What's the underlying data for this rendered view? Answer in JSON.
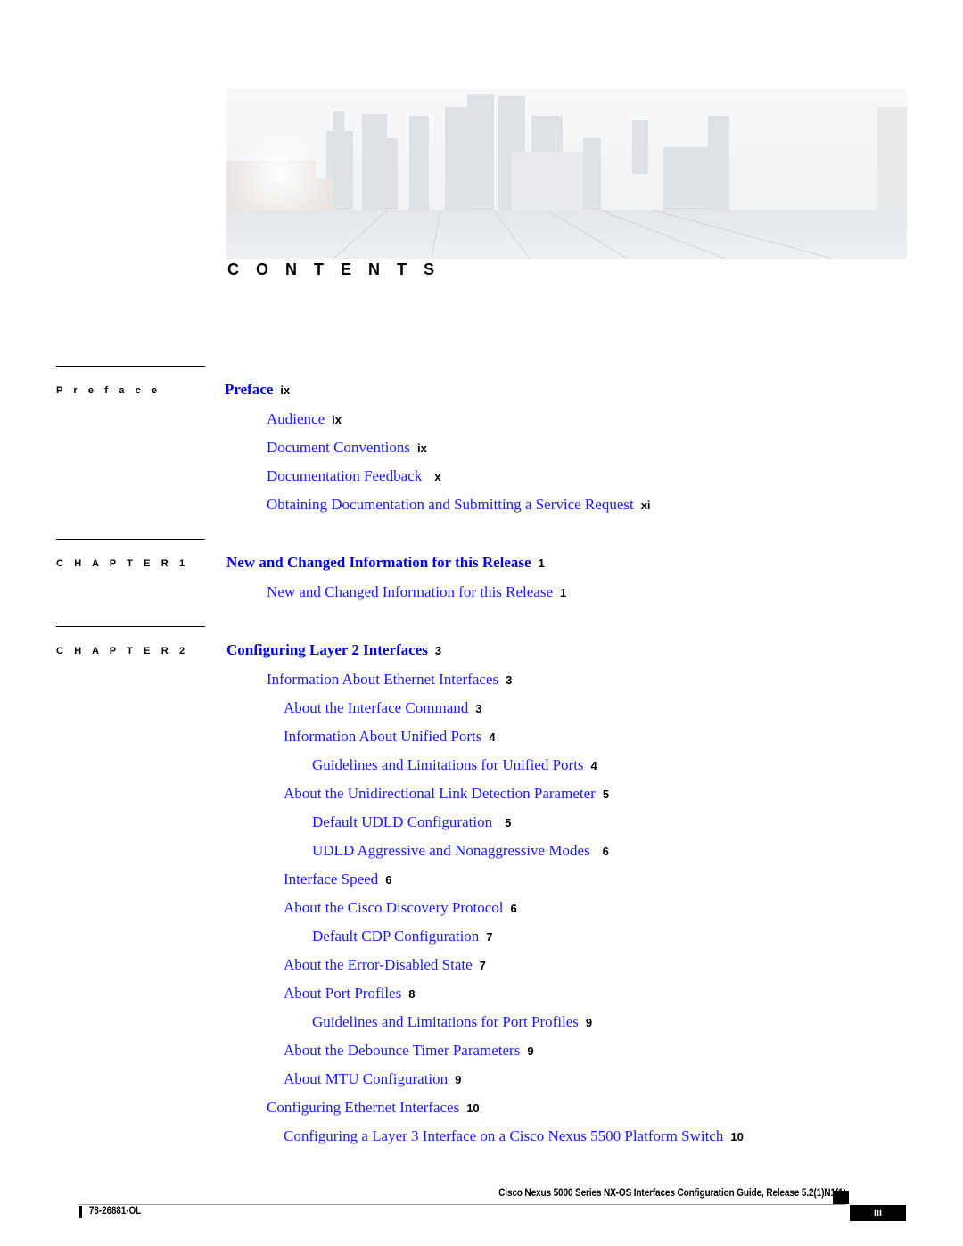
{
  "header": {
    "banner_alt": "city-skyline-bridge-photo",
    "title": "C O N T E N T S"
  },
  "sections": [
    {
      "label": "P r e f a c e",
      "heading": {
        "title": "Preface",
        "page": "ix"
      },
      "entries": [
        {
          "title": "Audience",
          "page": "ix",
          "level": 1
        },
        {
          "title": "Document Conventions",
          "page": "ix",
          "level": 1
        },
        {
          "title": "Documentation Feedback",
          "page": "x",
          "level": 1
        },
        {
          "title": "Obtaining Documentation and Submitting a Service Request",
          "page": "xi",
          "level": 1
        }
      ]
    },
    {
      "label": "C H A P T E R   1",
      "heading": {
        "title": "New and Changed Information for this Release",
        "page": "1"
      },
      "entries": [
        {
          "title": "New and Changed Information for this Release",
          "page": "1",
          "level": 1
        }
      ]
    },
    {
      "label": "C H A P T E R   2",
      "heading": {
        "title": "Configuring Layer 2 Interfaces",
        "page": "3"
      },
      "entries": [
        {
          "title": "Information About Ethernet Interfaces",
          "page": "3",
          "level": 1
        },
        {
          "title": "About the Interface Command",
          "page": "3",
          "level": 2
        },
        {
          "title": "Information About Unified Ports",
          "page": "4",
          "level": 2
        },
        {
          "title": "Guidelines and Limitations for Unified Ports",
          "page": "4",
          "level": 3
        },
        {
          "title": "About the Unidirectional Link Detection Parameter",
          "page": "5",
          "level": 2
        },
        {
          "title": "Default UDLD Configuration",
          "page": "5",
          "level": 3
        },
        {
          "title": "UDLD Aggressive and Nonaggressive Modes",
          "page": "6",
          "level": 3
        },
        {
          "title": "Interface Speed",
          "page": "6",
          "level": 2
        },
        {
          "title": "About the Cisco Discovery Protocol",
          "page": "6",
          "level": 2
        },
        {
          "title": "Default CDP Configuration",
          "page": "7",
          "level": 3
        },
        {
          "title": "About the Error-Disabled State",
          "page": "7",
          "level": 2
        },
        {
          "title": "About Port Profiles",
          "page": "8",
          "level": 2
        },
        {
          "title": "Guidelines and Limitations for Port Profiles",
          "page": "9",
          "level": 3
        },
        {
          "title": "About the Debounce Timer Parameters",
          "page": "9",
          "level": 2
        },
        {
          "title": "About MTU Configuration",
          "page": "9",
          "level": 2
        },
        {
          "title": "Configuring Ethernet Interfaces",
          "page": "10",
          "level": 1
        },
        {
          "title": "Configuring a Layer 3 Interface on a Cisco Nexus 5500 Platform Switch",
          "page": "10",
          "level": 2
        }
      ]
    }
  ],
  "footer": {
    "guide_title": "Cisco Nexus 5000 Series NX-OS Interfaces Configuration Guide, Release 5.2(1)N1(1)",
    "doc_number": "78-26881-OL",
    "page_number": "iii"
  }
}
